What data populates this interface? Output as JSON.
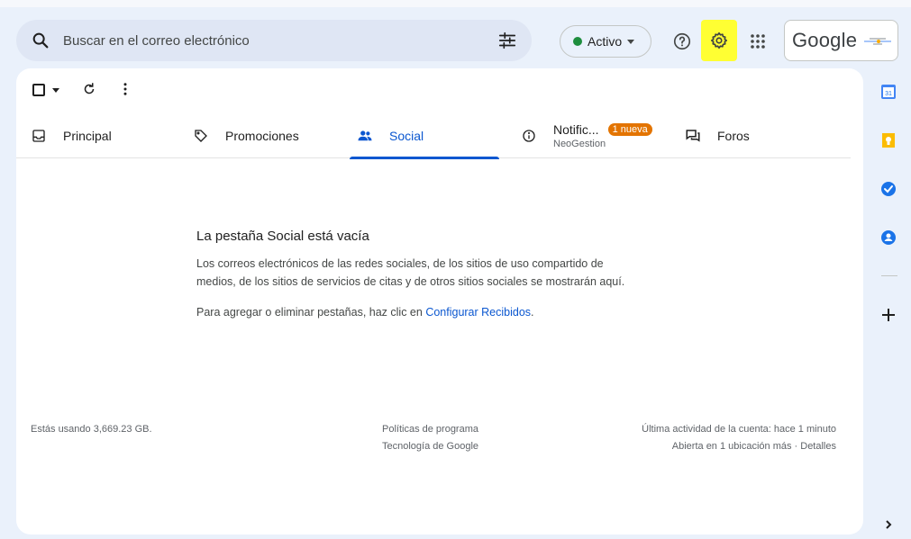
{
  "search": {
    "placeholder": "Buscar en el correo electrónico"
  },
  "status": {
    "label": "Activo",
    "color": "#1e8e3e"
  },
  "header": {
    "logo_text": "Google",
    "settings_highlight": "#ffff33"
  },
  "tabs": [
    {
      "label": "Principal"
    },
    {
      "label": "Promociones"
    },
    {
      "label": "Social"
    },
    {
      "label": "Notific...",
      "badge": "1 nueva",
      "sub": "NeoGestion"
    },
    {
      "label": "Foros"
    }
  ],
  "empty": {
    "title": "La pestaña Social está vacía",
    "line1": "Los correos electrónicos de las redes sociales, de los sitios de uso compartido de",
    "line2": "medios, de los sitios de servicios de citas y de otros sitios sociales se mostrarán aquí.",
    "hint_prefix": "Para agregar o eliminar pestañas, haz clic en ",
    "hint_link": "Configurar Recibidos",
    "hint_suffix": "."
  },
  "footer": {
    "storage": "Estás usando 3,669.23 GB.",
    "policies": "Políticas de programa",
    "tech": "Tecnología de Google",
    "activity": "Última actividad de la cuenta: hace 1 minuto",
    "location": "Abierta en 1 ubicación más · Detalles"
  },
  "rail": {
    "calendar_day": "31"
  },
  "colors": {
    "accent": "#0b57d0",
    "badge": "#e37400"
  }
}
